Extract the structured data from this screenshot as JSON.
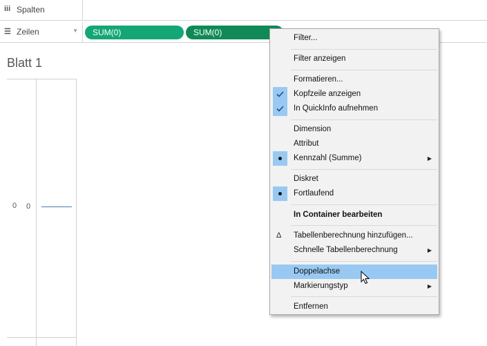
{
  "shelves": {
    "columns": {
      "label": "Spalten",
      "icon": "columns-icon"
    },
    "rows": {
      "label": "Zeilen",
      "icon": "rows-icon"
    }
  },
  "pills": [
    {
      "label": "SUM(0)",
      "color": "#13a676"
    },
    {
      "label": "SUM(0)",
      "color": "#0f8a57"
    }
  ],
  "sheet": {
    "title": "Blatt 1",
    "axis_tick": "0",
    "header_value": "0"
  },
  "context_menu": {
    "items": [
      {
        "label": "Filter..."
      },
      {
        "label": "Filter anzeigen"
      },
      {
        "label": "Formatieren..."
      },
      {
        "label": "Kopfzeile anzeigen",
        "checked": true
      },
      {
        "label": "In QuickInfo aufnehmen",
        "checked": true
      },
      {
        "label": "Dimension"
      },
      {
        "label": "Attribut"
      },
      {
        "label": "Kennzahl (Summe)",
        "selected": true,
        "submenu": true
      },
      {
        "label": "Diskret"
      },
      {
        "label": "Fortlaufend",
        "selected": true
      },
      {
        "label": "In Container bearbeiten",
        "bold": true
      },
      {
        "label": "Tabellenberechnung hinzufügen...",
        "icon": "delta-icon"
      },
      {
        "label": "Schnelle Tabellenberechnung",
        "submenu": true
      },
      {
        "label": "Doppelachse",
        "highlighted": true
      },
      {
        "label": "Markierungstyp",
        "submenu": true
      },
      {
        "label": "Entfernen"
      }
    ]
  },
  "colors": {
    "highlight": "#99c9f3",
    "menu_bg": "#f2f2f2",
    "mark_line": "#4e79a7"
  }
}
